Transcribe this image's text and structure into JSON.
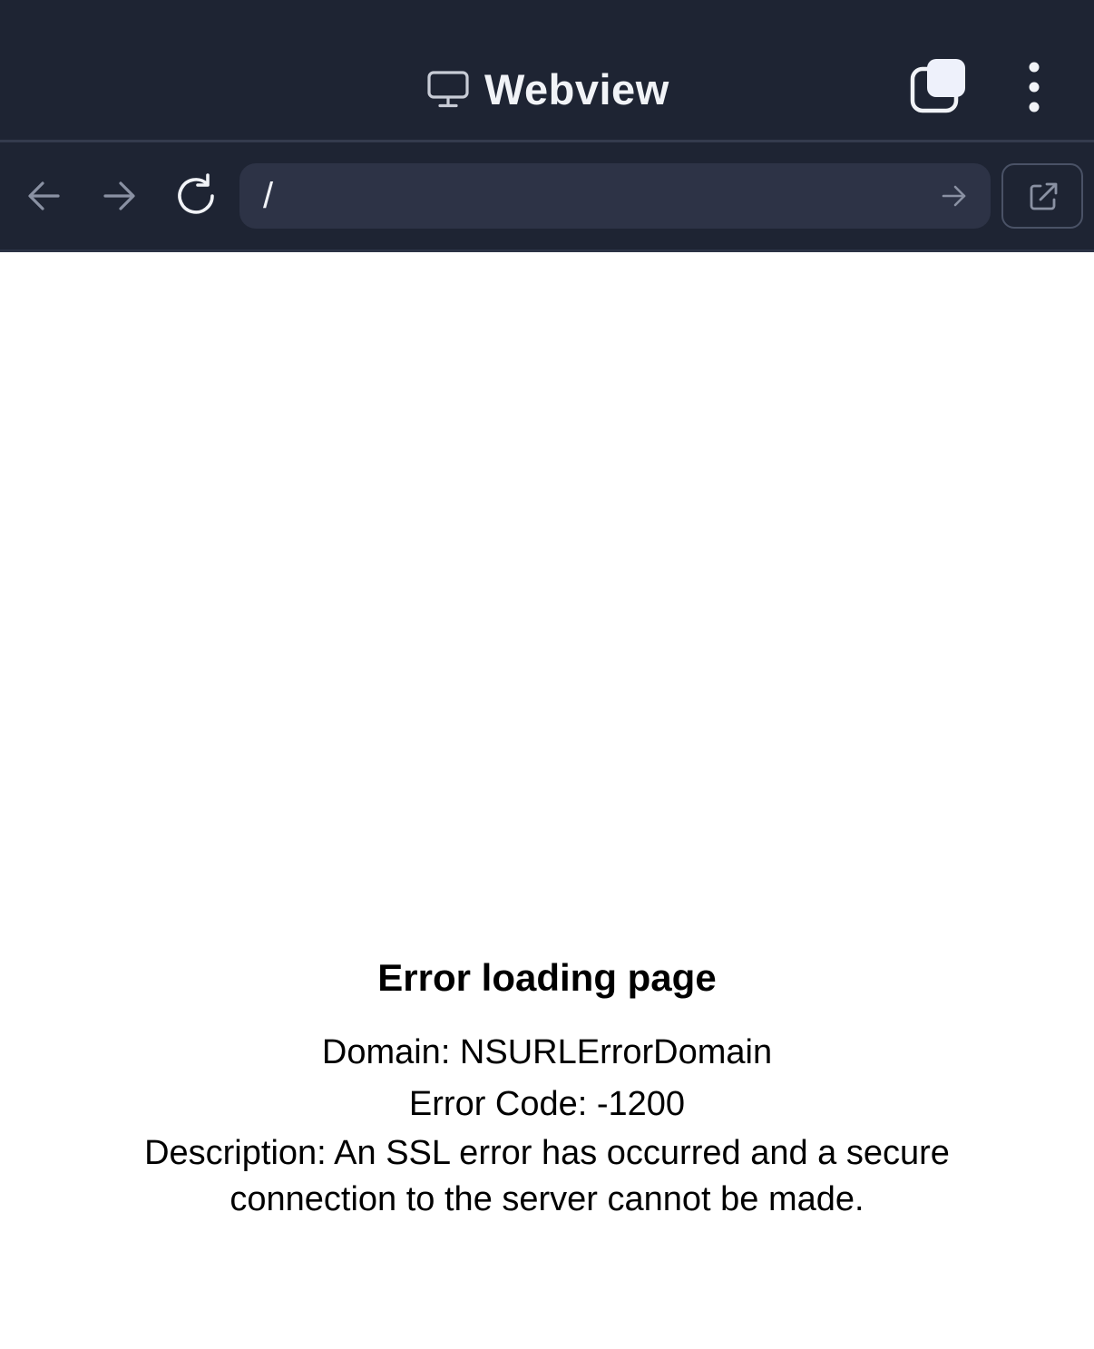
{
  "header": {
    "title": "Webview",
    "title_icon": "monitor-icon",
    "tabs_icon": "tabs-icon",
    "more_icon": "more-vertical-icon"
  },
  "toolbar": {
    "back_icon": "arrow-left-icon",
    "forward_icon": "arrow-right-icon",
    "reload_icon": "reload-icon",
    "url_value": "/",
    "go_icon": "arrow-right-icon",
    "external_icon": "external-link-icon"
  },
  "error": {
    "title": "Error loading page",
    "domain": "Domain: NSURLErrorDomain",
    "code": "Error Code: -1200",
    "description": "Description: An SSL error has occurred and a secure connection to the server cannot be made."
  },
  "colors": {
    "toolbar_bg": "#1e2433",
    "url_bg": "#2d3346",
    "text_light": "#f1f3f7",
    "icon_muted": "#8a91a3",
    "page_bg": "#ffffff"
  }
}
